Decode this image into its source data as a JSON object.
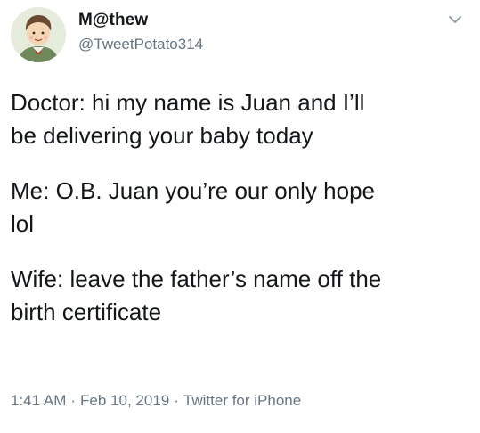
{
  "tweet": {
    "author": {
      "display_name": "M@thew",
      "handle": "@TweetPotato314",
      "avatar_icon": "cartoon-person-avatar"
    },
    "caret_icon": "chevron-down-icon",
    "paragraphs": [
      "Doctor: hi my name is Juan and I’ll\nbe delivering your baby today",
      "Me: O.B. Juan you’re our only hope\nlol",
      "Wife: leave the father’s name off the\nbirth certificate"
    ],
    "time": "1:41 AM",
    "separator": "·",
    "date": "Feb 10, 2019",
    "source": "Twitter for iPhone"
  },
  "colors": {
    "text": "#14171a",
    "secondary": "#657786",
    "background": "#ffffff"
  }
}
